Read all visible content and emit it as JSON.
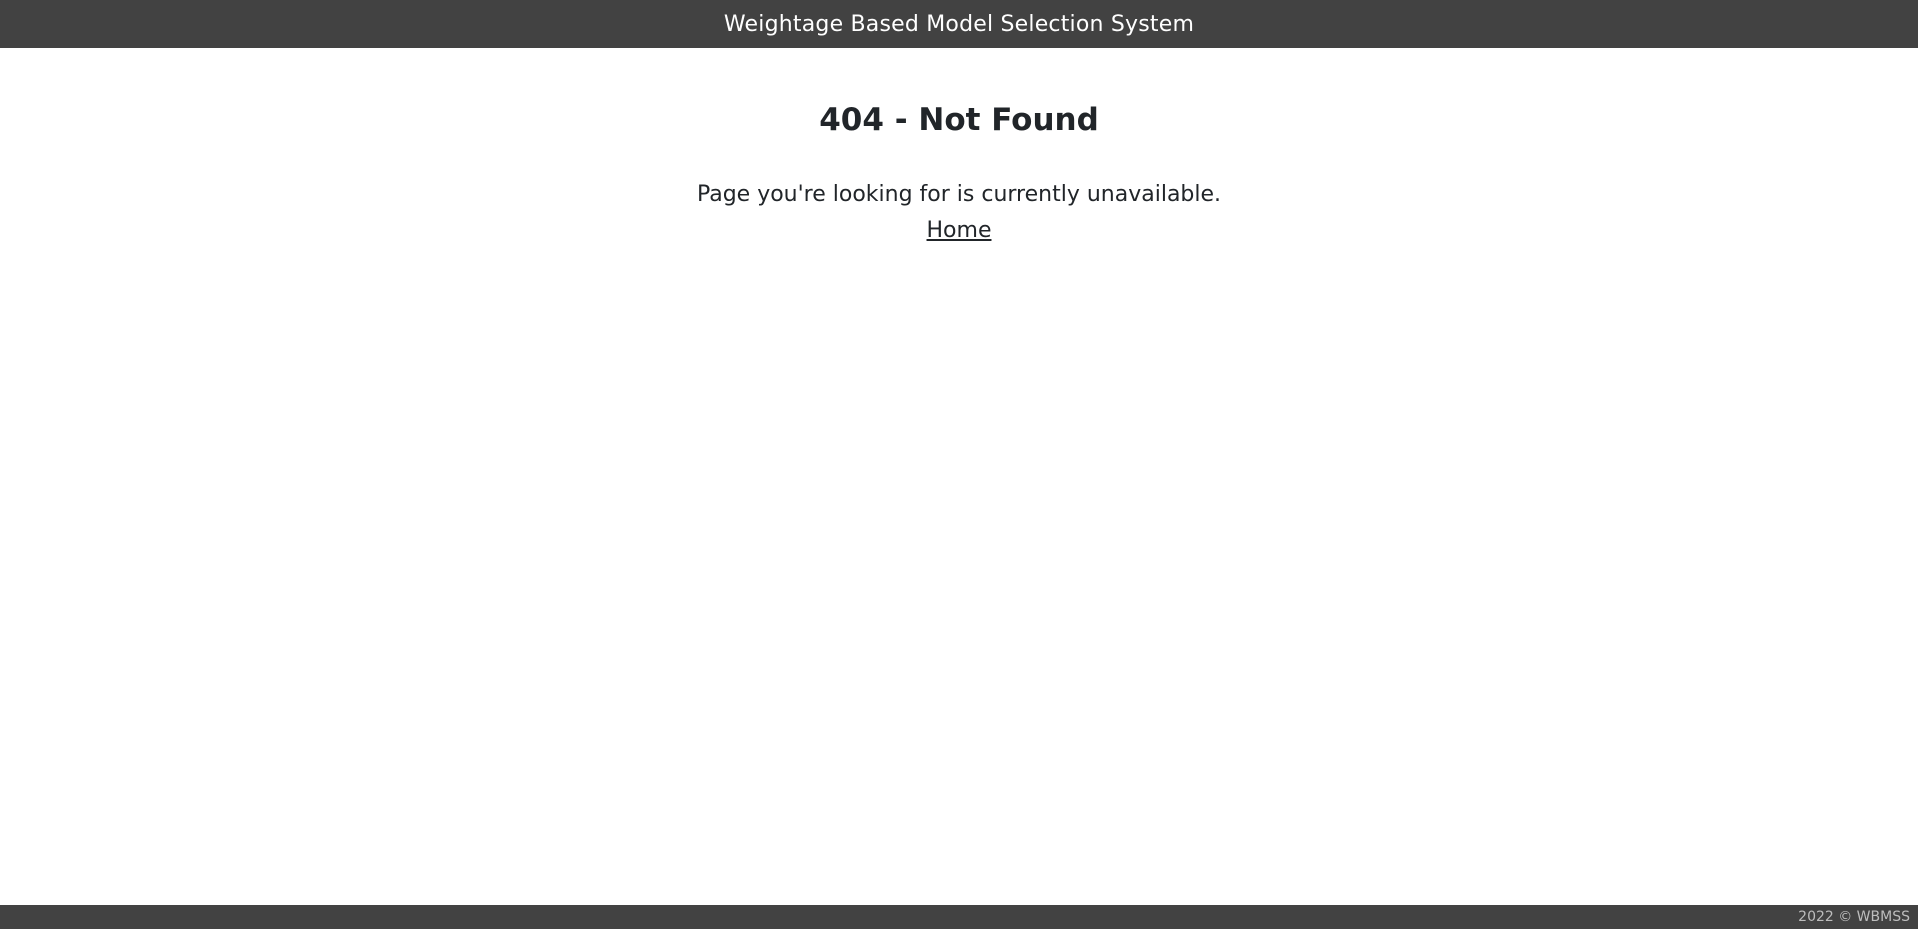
{
  "header": {
    "title": "Weightage Based Model Selection System"
  },
  "main": {
    "heading": "404 - Not Found",
    "message": "Page you're looking for is currently unavailable.",
    "home_link": "Home"
  },
  "footer": {
    "copyright": "2022 © WBMSS"
  },
  "colors": {
    "bar_background": "#424242",
    "page_background": "#ffffff",
    "text": "#212529",
    "footer_text": "#bdbdbd"
  }
}
